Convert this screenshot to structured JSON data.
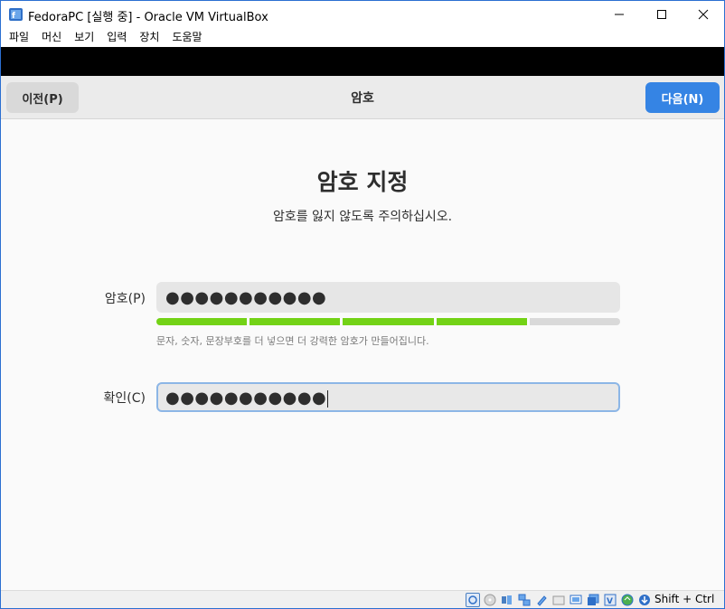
{
  "window": {
    "title": "FedoraPC [실행 중] - Oracle VM VirtualBox"
  },
  "menu": {
    "items": [
      "파일",
      "머신",
      "보기",
      "입력",
      "장치",
      "도움말"
    ]
  },
  "header": {
    "prev_label": "이전(P)",
    "title": "암호",
    "next_label": "다음(N)"
  },
  "page": {
    "title": "암호 지정",
    "subtitle": "암호를 잃지 않도록 주의하십시오."
  },
  "password": {
    "label": "암호(P)",
    "masked_value": "●●●●●●●●●●●",
    "strength_filled_segments": 4,
    "strength_total_segments": 5,
    "hint": "문자, 숫자, 문장부호를 더 넣으면 더 강력한 암호가 만들어집니다."
  },
  "confirm": {
    "label": "확인(C)",
    "masked_value": "●●●●●●●●●●●"
  },
  "statusbar": {
    "host_key": "Shift + Ctrl",
    "icons": [
      "hard-disk-icon",
      "optical-drive-icon",
      "audio-icon",
      "network-icon",
      "usb-icon",
      "shared-folders-icon",
      "display-icon",
      "video-capture-icon",
      "virtualization-icon",
      "mouse-integration-icon",
      "keyboard-capture-icon"
    ]
  },
  "colors": {
    "accent": "#3584e4",
    "strength": "#73d216",
    "window_border": "#2b6fd1"
  }
}
